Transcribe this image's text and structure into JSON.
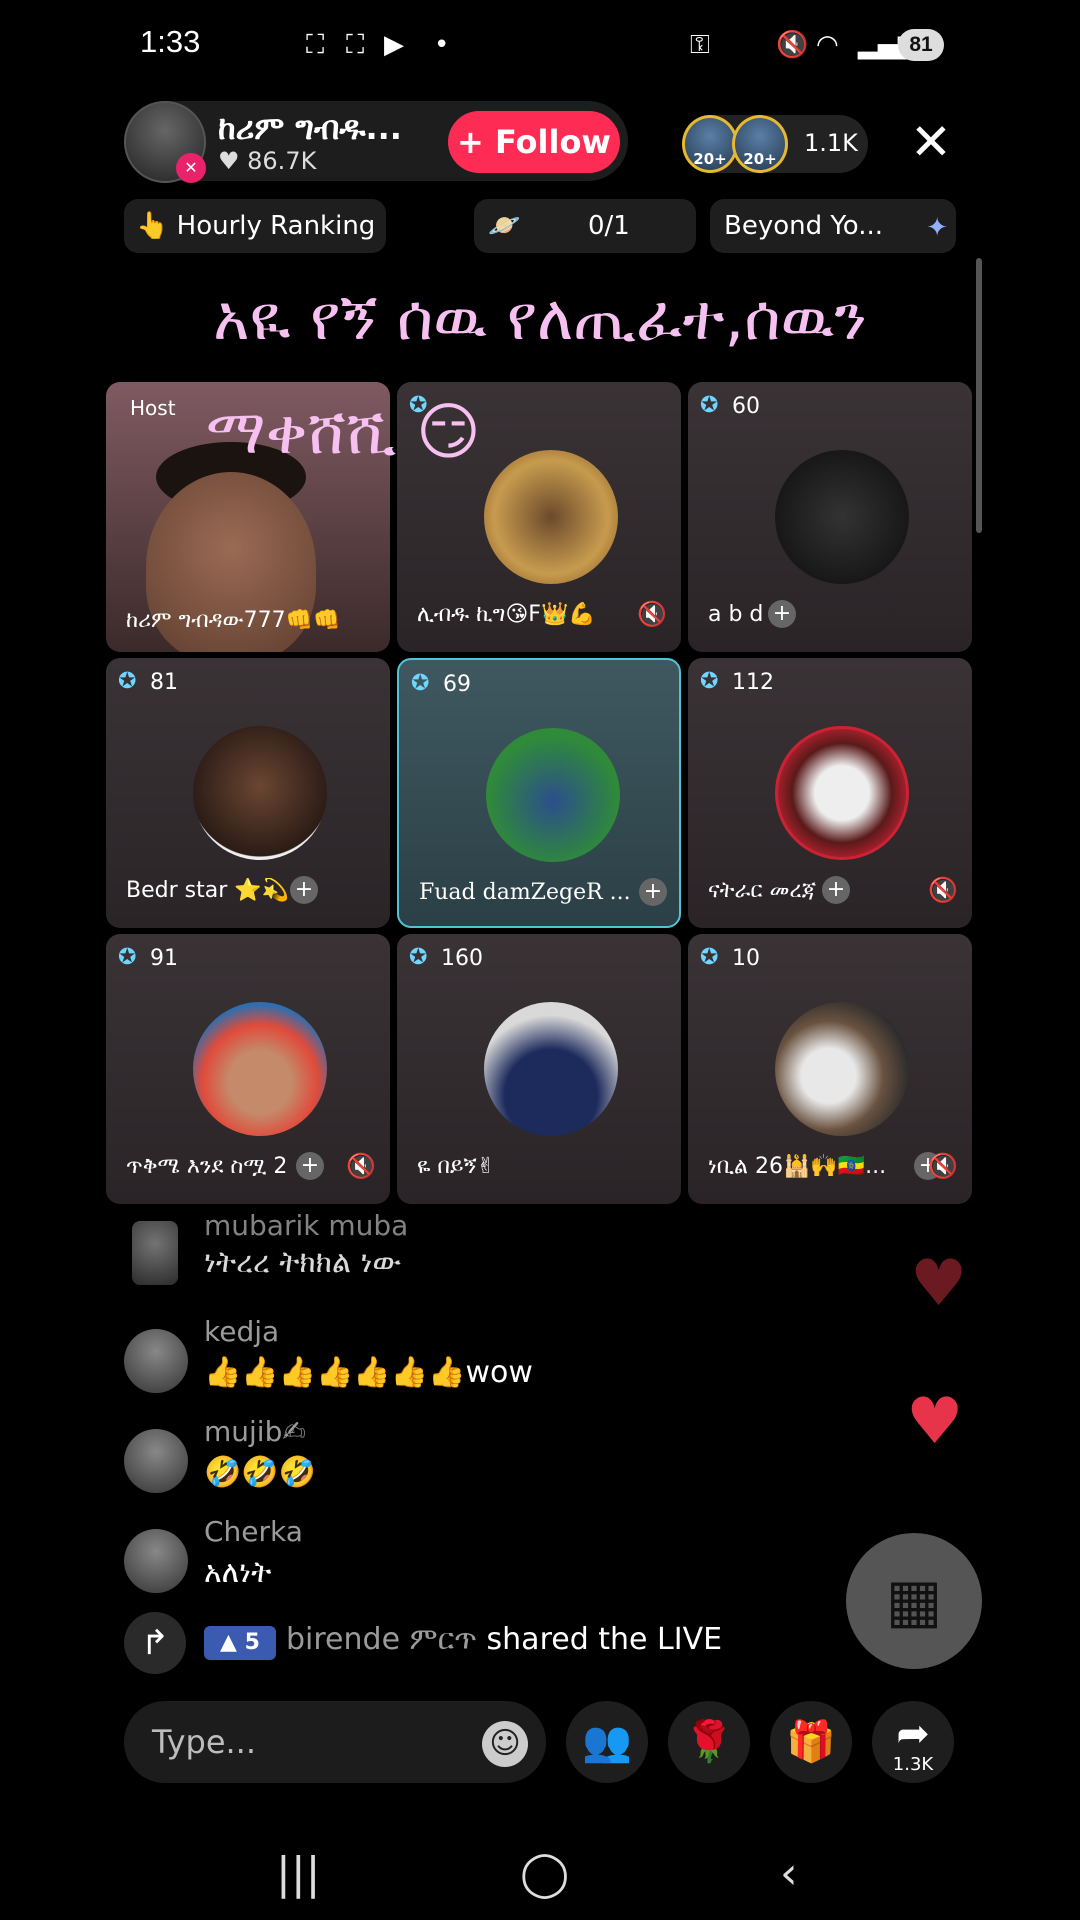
{
  "status_bar": {
    "time": "1:33",
    "battery": "81"
  },
  "host": {
    "name": "ከሪም ግብዱ...",
    "likes": "♥ 86.7K",
    "follow_label": "+ Follow"
  },
  "viewers": {
    "badges": [
      "20+",
      "20+"
    ],
    "count": "1.1K"
  },
  "pills": {
    "hourly": "👆 Hourly Ranking",
    "progress": "0/1",
    "beyond": "Beyond Yo..."
  },
  "banner": {
    "line1": "አዪ የኝ ሰዉ የለጢፈተ,ሰዉን",
    "line2": "ማቀሸሺ 😏"
  },
  "host_tile": {
    "label": "Host",
    "name": "ከሪም ግብዳው777👊👊"
  },
  "tiles": [
    {
      "score": "",
      "name": "ሊብዱ ኪግ😘F👑💪"
    },
    {
      "score": "60",
      "name": "a b d"
    },
    {
      "score": "81",
      "name": "Bedr star ⭐💫"
    },
    {
      "score": "69",
      "name": "Fuad damZegeR ..."
    },
    {
      "score": "112",
      "name": "ናትራር መረጃ"
    },
    {
      "score": "91",
      "name": "ጥቅሜ እንደ ስሟ 2"
    },
    {
      "score": "160",
      "name": "ዬ በይኝ✌"
    },
    {
      "score": "10",
      "name": "ነቢል 26🕌🙌🇪🇹..."
    }
  ],
  "comments": [
    {
      "user": "mubarik muba",
      "text": "ነትረረ ትክክል ነው"
    },
    {
      "user": "kedja",
      "text": "👍👍👍👍👍👍👍wow"
    },
    {
      "user": "mujib✍",
      "text": "🤣🤣🤣"
    },
    {
      "user": "Cherka",
      "text": "አለነት"
    }
  ],
  "share_row": {
    "level": "5",
    "user": "birende  ምርጥ",
    "action": " shared the LIVE"
  },
  "bottom": {
    "placeholder": "Type...",
    "share_count": "1.3K"
  },
  "colors": {
    "follow": "#fe2c55",
    "selected_tile": "#4fc4d6",
    "banner_text": "#f6c0f0",
    "heart": "#e8344a"
  }
}
